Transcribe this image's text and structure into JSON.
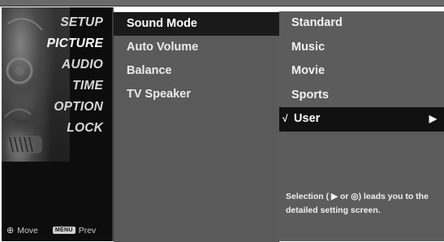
{
  "categories": [
    {
      "label": "SETUP",
      "active": false
    },
    {
      "label": "PICTURE",
      "active": true
    },
    {
      "label": "AUDIO",
      "active": false
    },
    {
      "label": "TIME",
      "active": false
    },
    {
      "label": "OPTION",
      "active": false
    },
    {
      "label": "LOCK",
      "active": false
    }
  ],
  "footer": {
    "move_icon": "⊕",
    "move_label": "Move",
    "menu_key": "MENU",
    "prev_label": "Prev"
  },
  "submenu": {
    "items": [
      {
        "label": "Sound Mode",
        "selected": true
      },
      {
        "label": "Auto Volume",
        "selected": false
      },
      {
        "label": "Balance",
        "selected": false
      },
      {
        "label": "TV Speaker",
        "selected": false
      }
    ]
  },
  "options": {
    "items": [
      {
        "label": "Standard",
        "current": false
      },
      {
        "label": "Music",
        "current": false
      },
      {
        "label": "Movie",
        "current": false
      },
      {
        "label": "Sports",
        "current": false
      },
      {
        "label": "User",
        "current": true,
        "check": "√",
        "arrow": "▶"
      }
    ],
    "help_text": "Selection ( ▶ or ◎) leads you to the detailed setting screen."
  }
}
